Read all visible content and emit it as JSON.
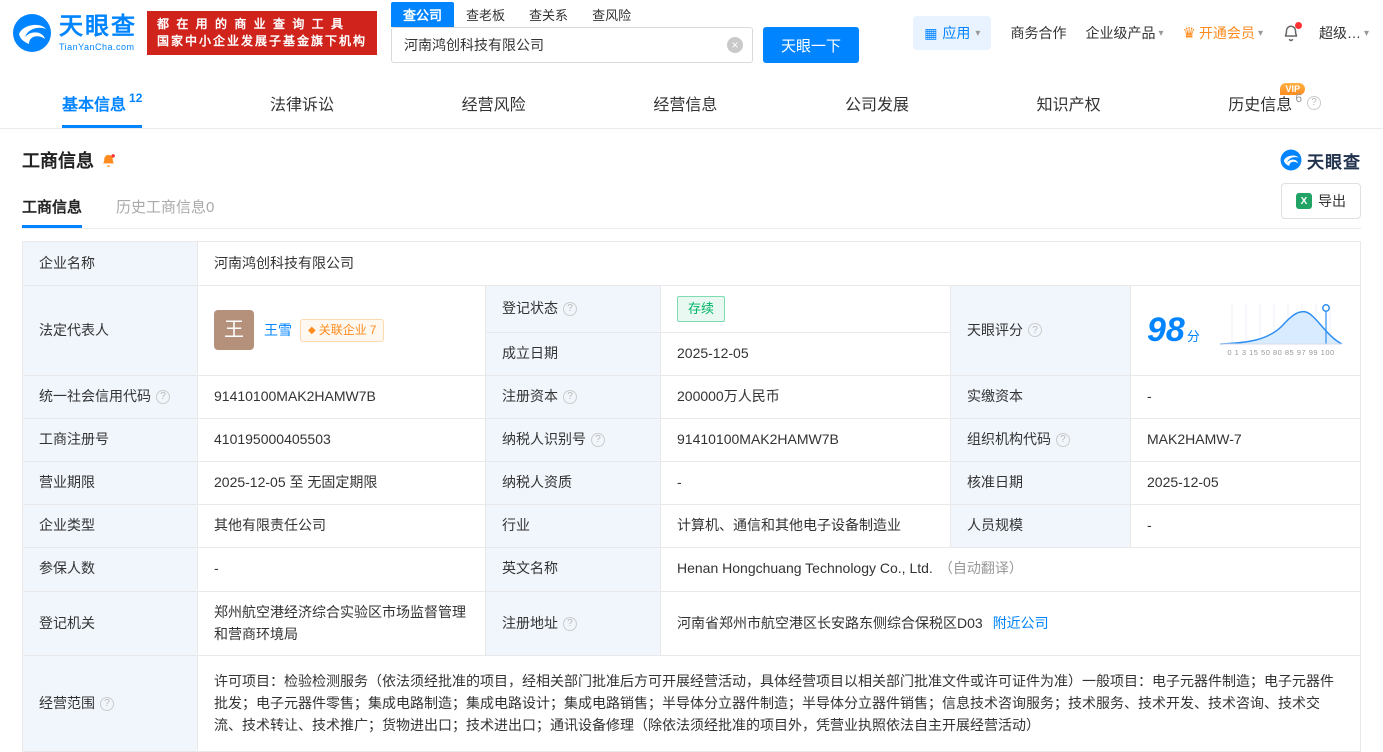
{
  "icons": {
    "help": "?",
    "caret": "▾",
    "clear": "×",
    "crown": "♛",
    "diamond": "◆",
    "grid": "▦",
    "excel": "X"
  },
  "header": {
    "logo": {
      "title": "天眼查",
      "domain": "TianYanCha.com"
    },
    "promo": {
      "line1": "都 在 用 的 商 业 查 询 工 具",
      "line2": "国家中小企业发展子基金旗下机构"
    },
    "search": {
      "tabs": [
        {
          "label": "查公司"
        },
        {
          "label": "查老板"
        },
        {
          "label": "查关系"
        },
        {
          "label": "查风险"
        }
      ],
      "value": "河南鸿创科技有限公司",
      "button": "天眼一下"
    },
    "right": {
      "apps": "应用",
      "cooperation": "商务合作",
      "enterprise": "企业级产品",
      "vip": "开通会员",
      "super": "超级…"
    }
  },
  "nav_tabs": [
    {
      "label": "基本信息",
      "count": "12"
    },
    {
      "label": "法律诉讼"
    },
    {
      "label": "经营风险"
    },
    {
      "label": "经营信息"
    },
    {
      "label": "公司发展"
    },
    {
      "label": "知识产权"
    },
    {
      "label": "历史信息",
      "count": "6",
      "badge": "VIP"
    }
  ],
  "section": {
    "title": "工商信息",
    "brand": "天眼查",
    "subtabs": [
      {
        "label": "工商信息"
      },
      {
        "label": "历史工商信息0"
      }
    ],
    "export": "导出"
  },
  "table": {
    "company_name": {
      "label": "企业名称",
      "value": "河南鸿创科技有限公司"
    },
    "legal_rep": {
      "label": "法定代表人",
      "avatar": "王",
      "name": "王雪",
      "related": "关联企业",
      "related_count": "7"
    },
    "reg_status": {
      "label": "登记状态",
      "value": "存续"
    },
    "establish_date": {
      "label": "成立日期",
      "value": "2025-12-05"
    },
    "score": {
      "label": "天眼评分",
      "value": "98",
      "unit": "分",
      "axis": "0 1 3 15 50 80 85 97 99 100"
    },
    "credit_code": {
      "label": "统一社会信用代码",
      "value": "91410100MAK2HAMW7B"
    },
    "reg_capital": {
      "label": "注册资本",
      "value": "200000万人民币"
    },
    "paid_capital": {
      "label": "实缴资本",
      "value": "-"
    },
    "reg_number": {
      "label": "工商注册号",
      "value": "410195000405503"
    },
    "taxpayer_id": {
      "label": "纳税人识别号",
      "value": "91410100MAK2HAMW7B"
    },
    "org_code": {
      "label": "组织机构代码",
      "value": "MAK2HAMW-7"
    },
    "business_term": {
      "label": "营业期限",
      "value": "2025-12-05 至 无固定期限"
    },
    "taxpayer_quality": {
      "label": "纳税人资质",
      "value": "-"
    },
    "approval_date": {
      "label": "核准日期",
      "value": "2025-12-05"
    },
    "company_type": {
      "label": "企业类型",
      "value": "其他有限责任公司"
    },
    "industry": {
      "label": "行业",
      "value": "计算机、通信和其他电子设备制造业"
    },
    "staff_size": {
      "label": "人员规模",
      "value": "-"
    },
    "insured_count": {
      "label": "参保人数",
      "value": "-"
    },
    "english_name": {
      "label": "英文名称",
      "value": "Henan Hongchuang Technology Co., Ltd.",
      "note": "（自动翻译）"
    },
    "reg_authority": {
      "label": "登记机关",
      "value": "郑州航空港经济综合实验区市场监督管理和营商环境局"
    },
    "reg_address": {
      "label": "注册地址",
      "value": "河南省郑州市航空港区长安路东侧综合保税区D03",
      "link": "附近公司"
    },
    "business_scope": {
      "label": "经营范围",
      "value": "许可项目：检验检测服务（依法须经批准的项目，经相关部门批准后方可开展经营活动，具体经营项目以相关部门批准文件或许可证件为准）一般项目：电子元器件制造；电子元器件批发；电子元器件零售；集成电路制造；集成电路设计；集成电路销售；半导体分立器件制造；半导体分立器件销售；信息技术咨询服务；技术服务、技术开发、技术咨询、技术交流、技术转让、技术推广；货物进出口；技术进出口；通讯设备修理（除依法须经批准的项目外，凭营业执照依法自主开展经营活动）"
    }
  },
  "colors": {
    "brand_blue": "#0084ff",
    "vip_orange": "#ff8b1f",
    "status_green": "#00b365",
    "promo_red": "#cf231c"
  }
}
